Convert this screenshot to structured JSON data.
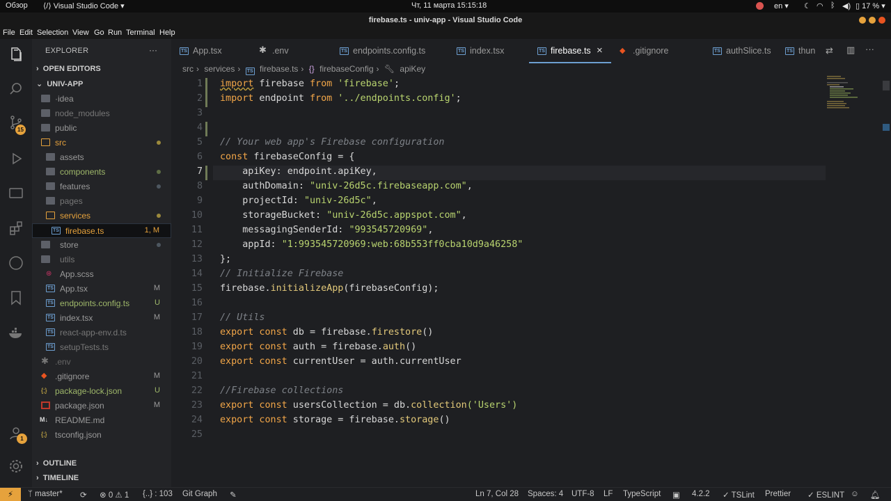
{
  "system_bar": {
    "overview": "Обзор",
    "app_name": "Visual Studio Code",
    "datetime": "Чт, 11 марта  15:15:18",
    "language": "en",
    "battery": "17 %"
  },
  "window": {
    "title": "firebase.ts - univ-app - Visual Studio Code"
  },
  "menu": [
    "File",
    "Edit",
    "Selection",
    "View",
    "Go",
    "Run",
    "Terminal",
    "Help"
  ],
  "activity": {
    "scm_badge": "15",
    "accounts_badge": "1"
  },
  "sidebar": {
    "title": "EXPLORER",
    "more": "···",
    "open_editors": "OPEN EDITORS",
    "project": "UNIV-APP",
    "outline": "OUTLINE",
    "timeline": "TIMELINE",
    "tree": [
      {
        "label": "·idea",
        "status": ""
      },
      {
        "label": "node_modules",
        "status": ""
      },
      {
        "label": "public",
        "status": ""
      },
      {
        "label": "src",
        "status": ""
      },
      {
        "label": "assets",
        "status": ""
      },
      {
        "label": "components",
        "status": ""
      },
      {
        "label": "features",
        "status": ""
      },
      {
        "label": "pages",
        "status": ""
      },
      {
        "label": "services",
        "status": ""
      },
      {
        "label": "firebase.ts",
        "status": "1, M"
      },
      {
        "label": "store",
        "status": ""
      },
      {
        "label": "utils",
        "status": ""
      },
      {
        "label": "App.scss",
        "status": ""
      },
      {
        "label": "App.tsx",
        "status": "M"
      },
      {
        "label": "endpoints.config.ts",
        "status": "U"
      },
      {
        "label": "index.tsx",
        "status": "M"
      },
      {
        "label": "react-app-env.d.ts",
        "status": ""
      },
      {
        "label": "setupTests.ts",
        "status": ""
      },
      {
        "label": ".env",
        "status": ""
      },
      {
        "label": ".gitignore",
        "status": "M"
      },
      {
        "label": "package-lock.json",
        "status": "U"
      },
      {
        "label": "package.json",
        "status": "M"
      },
      {
        "label": "README.md",
        "status": ""
      },
      {
        "label": "tsconfig.json",
        "status": ""
      }
    ]
  },
  "tabs": [
    "App.tsx",
    ".env",
    "endpoints.config.ts",
    "index.tsx",
    "firebase.ts",
    ".gitignore",
    "authSlice.ts",
    "thun"
  ],
  "tab_close": "×",
  "breadcrumb": [
    "src",
    "services",
    "firebase.ts",
    "firebaseConfig",
    "apiKey"
  ],
  "editor": {
    "line_numbers": [
      "1",
      "2",
      "3",
      "4",
      "5",
      "6",
      "7",
      "8",
      "9",
      "10",
      "11",
      "12",
      "13",
      "14",
      "15",
      "16",
      "17",
      "18",
      "19",
      "20",
      "21",
      "22",
      "23",
      "24",
      "25"
    ],
    "lines": {
      "l1_kw1": "import",
      "l1_a": " firebase ",
      "l1_kw2": "from",
      "l1_s": " 'firebase'",
      "l1_e": ";",
      "l2_kw1": "import",
      "l2_a": " endpoint ",
      "l2_kw2": "from",
      "l2_s": " '../endpoints.config'",
      "l2_e": ";",
      "l5": "// Your web app's Firebase configuration",
      "l6_kw": "const",
      "l6_a": " firebaseConfig = {",
      "l7": "    apiKey: endpoint.apiKey,",
      "l8_a": "    authDomain: ",
      "l8_s": "\"univ-26d5c.firebaseapp.com\"",
      "l8_e": ",",
      "l9_a": "    projectId: ",
      "l9_s": "\"univ-26d5c\"",
      "l9_e": ",",
      "l10_a": "    storageBucket: ",
      "l10_s": "\"univ-26d5c.appspot.com\"",
      "l10_e": ",",
      "l11_a": "    messagingSenderId: ",
      "l11_s": "\"993545720969\"",
      "l11_e": ",",
      "l12_a": "    appId: ",
      "l12_s": "\"1:993545720969:web:68b553ff0cba10d9a46258\"",
      "l13": "};",
      "l14": "// Initialize Firebase",
      "l15_a": "firebase.",
      "l15_f": "initializeApp",
      "l15_b": "(firebaseConfig);",
      "l17": "// Utils",
      "l18_kw": "export const",
      "l18_a": " db = firebase.",
      "l18_f": "firestore",
      "l18_b": "()",
      "l19_kw": "export const",
      "l19_a": " auth = firebase.",
      "l19_f": "auth",
      "l19_b": "()",
      "l20_kw": "export const",
      "l20_a": " currentUser = auth.currentUser",
      "l22": "//Firebase collections",
      "l23_kw": "export const",
      "l23_a": " usersCollection = db.",
      "l23_f": "collection",
      "l23_s": "('Users')",
      "l24_kw": "export const",
      "l24_a": " storage = firebase.",
      "l24_f": "storage",
      "l24_b": "()"
    }
  },
  "statusbar": {
    "remote": "⚡",
    "branch": "master*",
    "problems": "⊗ 0 ⚠ 1",
    "braces": "{..} : 103",
    "git_graph": "Git Graph",
    "position": "Ln 7, Col 28",
    "spaces": "Spaces: 4",
    "encoding": "UTF-8",
    "eol": "LF",
    "language": "TypeScript",
    "ts_version": "4.2.2",
    "tslint": "✓ TSLint",
    "prettier": "Prettier",
    "eslint": "✓ ESLINT"
  },
  "colors": {
    "accent": "#e6a23c",
    "keyword": "#f2a648",
    "string": "#b9d46f",
    "comment": "#7e8288",
    "ts_icon": "#6d9fd1"
  }
}
